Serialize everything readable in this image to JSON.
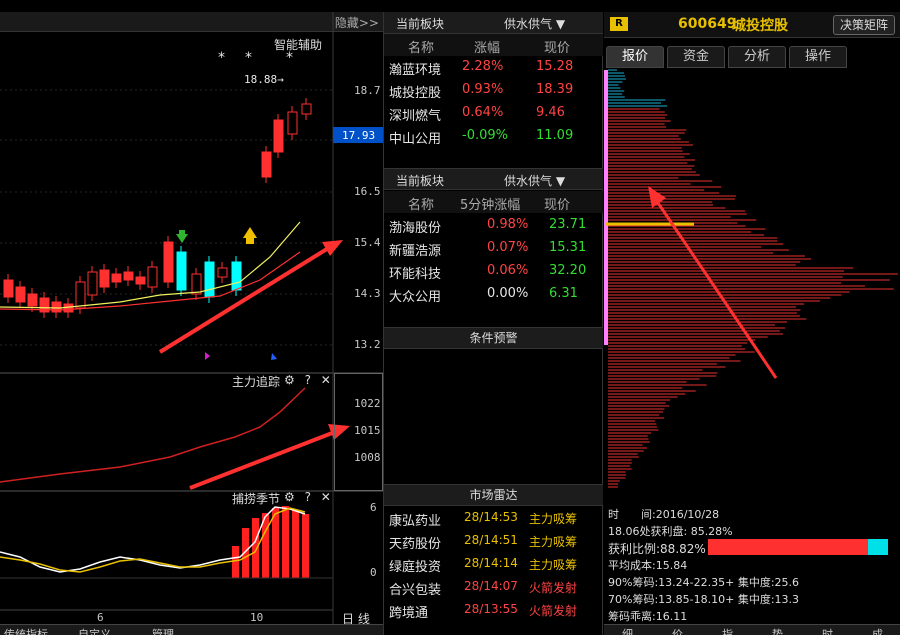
{
  "chart": {
    "hide_label": "隐藏>>",
    "assistant_label": "智能辅助",
    "stars": [
      "*",
      "*",
      "*"
    ],
    "high_marker": "18.88→",
    "yaxis_main": [
      "18.7",
      "16.5",
      "15.4",
      "14.3",
      "13.2"
    ],
    "current_price": "17.93",
    "yaxis_mid": [
      "1022",
      "1015",
      "1008"
    ],
    "yaxis_low": [
      "6",
      "0"
    ],
    "indicator1": {
      "name": "主力追踪",
      "icons": "⚙ ? ✕"
    },
    "indicator2": {
      "name": "捕捞季节",
      "icons": "⚙ ? ✕"
    },
    "xlabels": [
      "6",
      "10"
    ],
    "period_label": "日 线",
    "bottom_tabs": [
      "传统指标",
      "自定义",
      "管理"
    ]
  },
  "sector1": {
    "title": "当前板块",
    "sector": "供水供气 ▼",
    "headers": [
      "名称",
      "涨幅",
      "现价"
    ],
    "rows": [
      {
        "name": "瀚蓝环境",
        "chg": "2.28%",
        "price": "15.28",
        "dir": "up"
      },
      {
        "name": "城投控股",
        "chg": "0.93%",
        "price": "18.39",
        "dir": "up"
      },
      {
        "name": "深圳燃气",
        "chg": "0.64%",
        "price": "9.46",
        "dir": "up"
      },
      {
        "name": "中山公用",
        "chg": "-0.09%",
        "price": "11.09",
        "dir": "down"
      }
    ]
  },
  "sector2": {
    "title": "当前板块",
    "sector": "供水供气 ▼",
    "headers": [
      "名称",
      "5分钟涨幅",
      "现价"
    ],
    "rows": [
      {
        "name": "渤海股份",
        "chg": "0.98%",
        "price": "23.71",
        "dir": "up"
      },
      {
        "name": "新疆浩源",
        "chg": "0.07%",
        "price": "15.31",
        "dir": "up"
      },
      {
        "name": "环能科技",
        "chg": "0.06%",
        "price": "32.20",
        "dir": "up"
      },
      {
        "name": "大众公用",
        "chg": "0.00%",
        "price": "6.31",
        "dir": "flat"
      }
    ]
  },
  "alert": {
    "title": "条件预警"
  },
  "radar": {
    "title": "市场雷达",
    "rows": [
      {
        "name": "康弘药业",
        "time": "28/14:53",
        "event": "主力吸筹",
        "type": "buy"
      },
      {
        "name": "天药股份",
        "time": "28/14:51",
        "event": "主力吸筹",
        "type": "buy"
      },
      {
        "name": "绿庭投资",
        "time": "28/14:14",
        "event": "主力吸筹",
        "type": "buy"
      },
      {
        "name": "合兴包装",
        "time": "28/14:07",
        "event": "火箭发射",
        "type": "rocket"
      },
      {
        "name": "跨境通",
        "time": "28/13:55",
        "event": "火箭发射",
        "type": "rocket"
      }
    ]
  },
  "stock": {
    "badge": "R",
    "code": "600649",
    "name": "城投控股",
    "matrix_btn": "决策矩阵",
    "tabs": [
      "报价",
      "资金",
      "分析",
      "操作"
    ],
    "stats": [
      "时　　间:2016/10/28",
      "18.06处获利盘: 85.28%",
      "获利比例:88.82%",
      "平均成本:15.84",
      "90%筹码:13.24-22.35+ 集中度:25.6",
      "70%筹码:13.85-18.10+ 集中度:13.3",
      "筹码乖离:16.11"
    ],
    "profit_ratio": 0.8882,
    "bottom_tabs": [
      "细",
      "价",
      "指",
      "势",
      "时",
      "成"
    ]
  },
  "colors": {
    "up": "#ff4444",
    "down": "#33dd33",
    "flat": "#e6e6e6",
    "accent": "#0050c8"
  }
}
